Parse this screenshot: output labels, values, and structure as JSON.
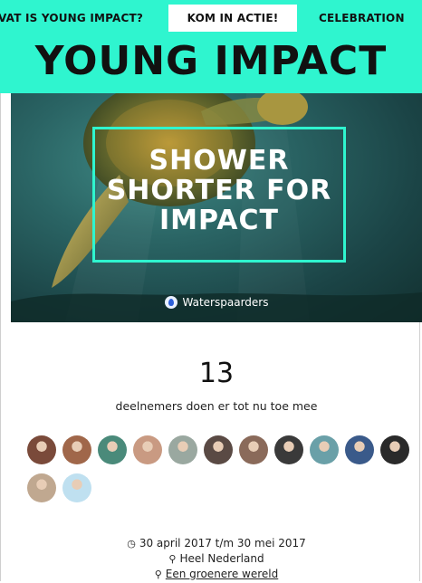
{
  "nav": {
    "items": [
      {
        "label": "VAT IS YOUNG IMPACT?"
      },
      {
        "label": "KOM IN ACTIE!"
      },
      {
        "label": "CELEBRATION"
      }
    ]
  },
  "brand": {
    "title": "YOUNG IMPACT"
  },
  "hero": {
    "title_lines": [
      "SHOWER",
      "SHORTER FOR",
      "IMPACT"
    ],
    "organization": "Waterspaarders"
  },
  "stats": {
    "count": "13",
    "label": "deelnemers doen er tot nu toe mee"
  },
  "participants": [
    {
      "color": "#7a4a3a"
    },
    {
      "color": "#a0674a"
    },
    {
      "color": "#4a8a7a"
    },
    {
      "color": "#c99a82"
    },
    {
      "color": "#9aa8a0"
    },
    {
      "color": "#5a4a44"
    },
    {
      "color": "#8a6a5a"
    },
    {
      "color": "#3a3a3a"
    },
    {
      "color": "#6aa0a8"
    },
    {
      "color": "#3a5a8a"
    },
    {
      "color": "#2a2a2a"
    },
    {
      "color": "#c0a890"
    },
    {
      "color": "#bfe0f0"
    }
  ],
  "details": {
    "dates": "30 april 2017 t/m 30 mei 2017",
    "location": "Heel Nederland",
    "theme": "Een groenere wereld"
  },
  "colors": {
    "accent": "#2ff5cf"
  }
}
